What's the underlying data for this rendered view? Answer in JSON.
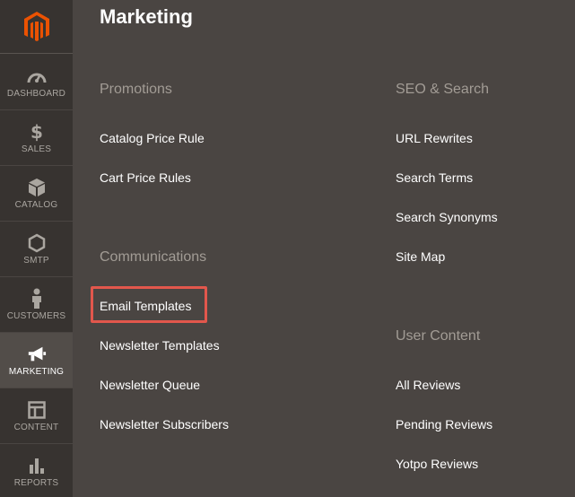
{
  "sidebar": {
    "items": [
      {
        "key": "dashboard",
        "label": "DASHBOARD",
        "icon": "dashboard-icon",
        "active": false
      },
      {
        "key": "sales",
        "label": "SALES",
        "icon": "dollar-icon",
        "active": false
      },
      {
        "key": "catalog",
        "label": "CATALOG",
        "icon": "cube-icon",
        "active": false
      },
      {
        "key": "smtp",
        "label": "SMTP",
        "icon": "hexagon-icon",
        "active": false
      },
      {
        "key": "customers",
        "label": "CUSTOMERS",
        "icon": "person-icon",
        "active": false
      },
      {
        "key": "marketing",
        "label": "MARKETING",
        "icon": "megaphone-icon",
        "active": true
      },
      {
        "key": "content",
        "label": "CONTENT",
        "icon": "layout-icon",
        "active": false
      },
      {
        "key": "reports",
        "label": "REPORTS",
        "icon": "bar-chart-icon",
        "active": false
      }
    ]
  },
  "page": {
    "title": "Marketing"
  },
  "sections": {
    "promotions": {
      "title": "Promotions",
      "items": [
        "Catalog Price Rule",
        "Cart Price Rules"
      ]
    },
    "communications": {
      "title": "Communications",
      "items": [
        "Email Templates",
        "Newsletter Templates",
        "Newsletter Queue",
        "Newsletter Subscribers"
      ]
    },
    "seo": {
      "title": "SEO & Search",
      "items": [
        "URL Rewrites",
        "Search Terms",
        "Search Synonyms",
        "Site Map"
      ]
    },
    "user_content": {
      "title": "User Content",
      "items": [
        "All Reviews",
        "Pending Reviews",
        "Yotpo Reviews"
      ]
    }
  },
  "colors": {
    "sidebar_bg": "#373330",
    "panel_bg": "#4a4542",
    "active_bg": "#524d49",
    "brand_orange": "#eb5202",
    "highlight": "#e2574c"
  }
}
